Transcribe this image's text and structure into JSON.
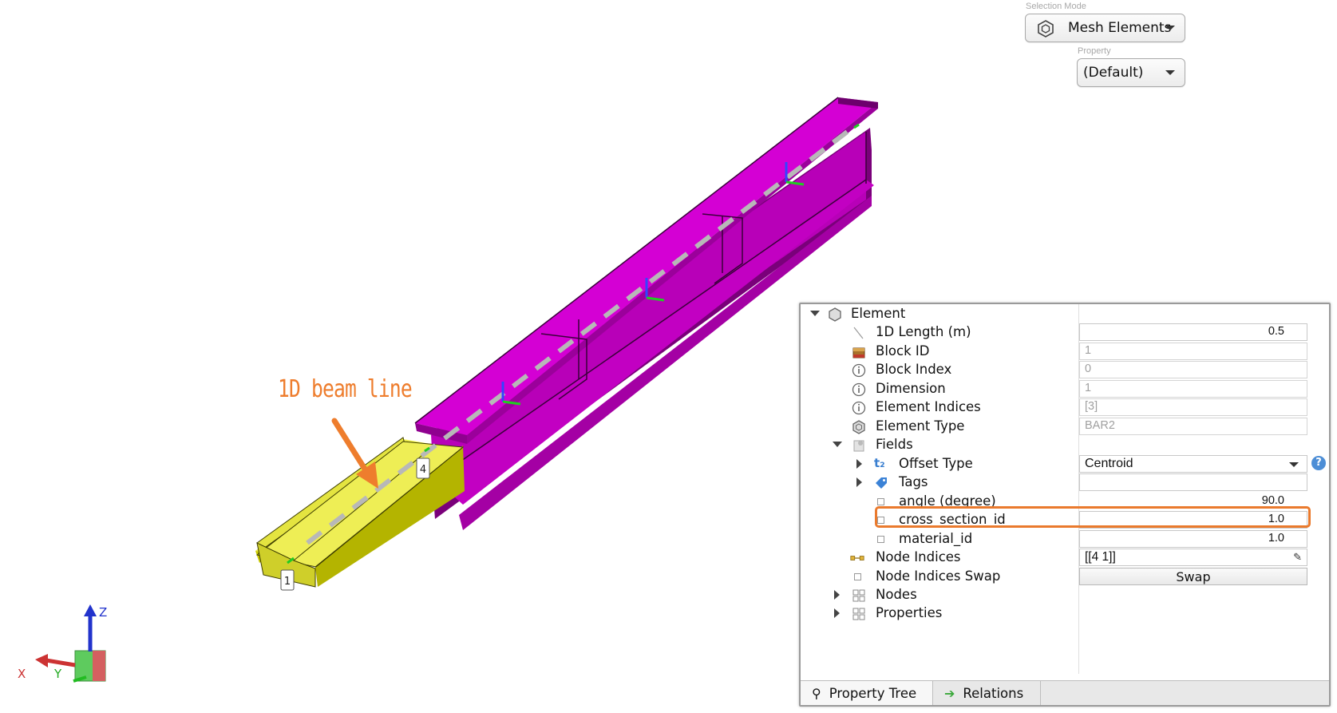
{
  "selection_mode": {
    "label": "Selection Mode",
    "value": "Mesh Elements",
    "icon": "hexagon-mesh-icon"
  },
  "property_selector": {
    "label": "Property",
    "value": "(Default)"
  },
  "viewport": {
    "annotation": "1D beam line",
    "node_labels": [
      "1",
      "4"
    ],
    "axes": {
      "x": "X",
      "y": "Y",
      "z": "Z"
    },
    "colors": {
      "beam": "#d400d4",
      "selected": "#e8e832",
      "centerline": "#b8b8b8",
      "annotation": "#ee7d2d"
    }
  },
  "property_tree": {
    "root": "Element",
    "rows": [
      {
        "label": "1D Length (m)",
        "value": "0.5",
        "icon": "line-icon"
      },
      {
        "label": "Block ID",
        "value": "1",
        "icon": "block-icon",
        "readonly": true
      },
      {
        "label": "Block Index",
        "value": "0",
        "icon": "info-icon",
        "readonly": true
      },
      {
        "label": "Dimension",
        "value": "1",
        "icon": "info-icon",
        "readonly": true
      },
      {
        "label": "Element Indices",
        "value": "[3]",
        "icon": "info-icon",
        "readonly": true
      },
      {
        "label": "Element Type",
        "value": "BAR2",
        "icon": "hexagon-icon",
        "readonly": true
      }
    ],
    "fields": {
      "label": "Fields",
      "offset_type": {
        "label": "Offset Type",
        "value": "Centroid"
      },
      "tags": {
        "label": "Tags",
        "value": ""
      },
      "angle": {
        "label": "angle (degree)",
        "value": "90.0"
      },
      "cross_section_id": {
        "label": "cross_section_id",
        "value": "1.0"
      },
      "material_id": {
        "label": "material_id",
        "value": "1.0"
      }
    },
    "node_indices": {
      "label": "Node Indices",
      "value": "[[4 1]]"
    },
    "node_indices_swap": {
      "label": "Node Indices Swap",
      "button": "Swap"
    },
    "nodes": {
      "label": "Nodes"
    },
    "properties": {
      "label": "Properties"
    }
  },
  "tabs": [
    {
      "label": "Property Tree",
      "icon": "search-icon"
    },
    {
      "label": "Relations",
      "icon": "arrow-right-icon"
    }
  ],
  "highlight_color": "#ea7a2d"
}
